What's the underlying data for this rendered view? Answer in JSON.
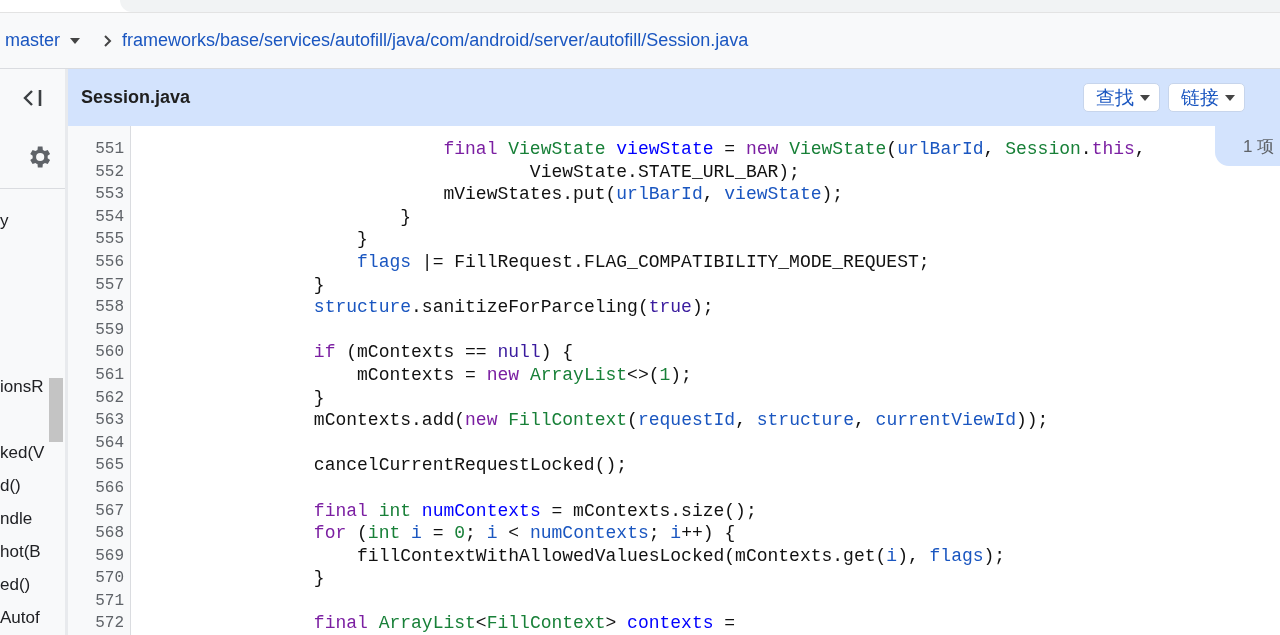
{
  "breadcrumb": {
    "branch": "master",
    "path": "frameworks/base/services/autofill/java/com/android/server/autofill/Session.java"
  },
  "file_header": {
    "title": "Session.java",
    "buttons": [
      {
        "label": "查找",
        "kind": "dropdown"
      },
      {
        "label": "链接",
        "kind": "dropdown"
      }
    ]
  },
  "side_tab": {
    "label": "1 项"
  },
  "sidebar": {
    "items": [
      {
        "kind": "text",
        "label": "y"
      },
      {
        "kind": "blank"
      },
      {
        "kind": "blank"
      },
      {
        "kind": "blank"
      },
      {
        "kind": "blank"
      },
      {
        "kind": "text",
        "label": "ionsR"
      },
      {
        "kind": "blank"
      },
      {
        "kind": "text",
        "label": "ked(V"
      },
      {
        "kind": "text",
        "label": "d()"
      },
      {
        "kind": "text",
        "label": "ndle"
      },
      {
        "kind": "text",
        "label": "hot(B"
      },
      {
        "kind": "text",
        "label": "ed()"
      },
      {
        "kind": "text",
        "label": "Autof"
      }
    ]
  },
  "code": {
    "lines": [
      {
        "number": "551",
        "tokens": [
          {
            "kind": "keyword",
            "text": "                            final "
          },
          {
            "kind": "type",
            "text": "ViewState "
          },
          {
            "kind": "decl",
            "text": "viewState"
          },
          {
            "kind": "plain",
            "text": " = "
          },
          {
            "kind": "keyword",
            "text": "new "
          },
          {
            "kind": "type",
            "text": "ViewState"
          },
          {
            "kind": "plain",
            "text": "("
          },
          {
            "kind": "ident",
            "text": "urlBarId"
          },
          {
            "kind": "plain",
            "text": ", "
          },
          {
            "kind": "type",
            "text": "Session"
          },
          {
            "kind": "plain",
            "text": "."
          },
          {
            "kind": "keyword",
            "text": "this"
          },
          {
            "kind": "plain",
            "text": ","
          }
        ]
      },
      {
        "number": "552",
        "tokens": [
          {
            "kind": "plain",
            "text": "                                    ViewState.STATE_URL_BAR);"
          }
        ]
      },
      {
        "number": "553",
        "tokens": [
          {
            "kind": "plain",
            "text": "                            mViewStates.put("
          },
          {
            "kind": "ident",
            "text": "urlBarId"
          },
          {
            "kind": "plain",
            "text": ", "
          },
          {
            "kind": "ident",
            "text": "viewState"
          },
          {
            "kind": "plain",
            "text": ");"
          }
        ]
      },
      {
        "number": "554",
        "tokens": [
          {
            "kind": "plain",
            "text": "                        }"
          }
        ]
      },
      {
        "number": "555",
        "tokens": [
          {
            "kind": "plain",
            "text": "                    }"
          }
        ]
      },
      {
        "number": "556",
        "tokens": [
          {
            "kind": "ident",
            "text": "                    flags"
          },
          {
            "kind": "plain",
            "text": " |= FillRequest.FLAG_COMPATIBILITY_MODE_REQUEST;"
          }
        ]
      },
      {
        "number": "557",
        "tokens": [
          {
            "kind": "plain",
            "text": "                }"
          }
        ]
      },
      {
        "number": "558",
        "tokens": [
          {
            "kind": "ident",
            "text": "                structure"
          },
          {
            "kind": "plain",
            "text": ".sanitizeForParceling("
          },
          {
            "kind": "literal",
            "text": "true"
          },
          {
            "kind": "plain",
            "text": ");"
          }
        ]
      },
      {
        "number": "559"
      },
      {
        "number": "560",
        "tokens": [
          {
            "kind": "keyword",
            "text": "                if"
          },
          {
            "kind": "plain",
            "text": " (mContexts == "
          },
          {
            "kind": "literal",
            "text": "null"
          },
          {
            "kind": "plain",
            "text": ") {"
          }
        ]
      },
      {
        "number": "561",
        "tokens": [
          {
            "kind": "plain",
            "text": "                    mContexts = "
          },
          {
            "kind": "keyword",
            "text": "new "
          },
          {
            "kind": "type",
            "text": "ArrayList"
          },
          {
            "kind": "plain",
            "text": "<>("
          },
          {
            "kind": "number",
            "text": "1"
          },
          {
            "kind": "plain",
            "text": ");"
          }
        ]
      },
      {
        "number": "562",
        "tokens": [
          {
            "kind": "plain",
            "text": "                }"
          }
        ]
      },
      {
        "number": "563",
        "tokens": [
          {
            "kind": "plain",
            "text": "                mContexts.add("
          },
          {
            "kind": "keyword",
            "text": "new "
          },
          {
            "kind": "type",
            "text": "FillContext"
          },
          {
            "kind": "plain",
            "text": "("
          },
          {
            "kind": "ident",
            "text": "requestId"
          },
          {
            "kind": "plain",
            "text": ", "
          },
          {
            "kind": "ident",
            "text": "structure"
          },
          {
            "kind": "plain",
            "text": ", "
          },
          {
            "kind": "ident",
            "text": "currentViewId"
          },
          {
            "kind": "plain",
            "text": "));"
          }
        ]
      },
      {
        "number": "564"
      },
      {
        "number": "565",
        "tokens": [
          {
            "kind": "plain",
            "text": "                cancelCurrentRequestLocked();"
          }
        ]
      },
      {
        "number": "566"
      },
      {
        "number": "567",
        "tokens": [
          {
            "kind": "keyword",
            "text": "                final "
          },
          {
            "kind": "type",
            "text": "int "
          },
          {
            "kind": "decl",
            "text": "numContexts"
          },
          {
            "kind": "plain",
            "text": " = mContexts.size();"
          }
        ]
      },
      {
        "number": "568",
        "tokens": [
          {
            "kind": "keyword",
            "text": "                for"
          },
          {
            "kind": "plain",
            "text": " ("
          },
          {
            "kind": "type",
            "text": "int "
          },
          {
            "kind": "ident",
            "text": "i"
          },
          {
            "kind": "plain",
            "text": " = "
          },
          {
            "kind": "number",
            "text": "0"
          },
          {
            "kind": "plain",
            "text": "; "
          },
          {
            "kind": "ident",
            "text": "i"
          },
          {
            "kind": "plain",
            "text": " < "
          },
          {
            "kind": "ident",
            "text": "numContexts"
          },
          {
            "kind": "plain",
            "text": "; "
          },
          {
            "kind": "ident",
            "text": "i"
          },
          {
            "kind": "plain",
            "text": "++) {"
          }
        ]
      },
      {
        "number": "569",
        "tokens": [
          {
            "kind": "plain",
            "text": "                    fillContextWithAllowedValuesLocked(mContexts.get("
          },
          {
            "kind": "ident",
            "text": "i"
          },
          {
            "kind": "plain",
            "text": "), "
          },
          {
            "kind": "ident",
            "text": "flags"
          },
          {
            "kind": "plain",
            "text": ");"
          }
        ]
      },
      {
        "number": "570",
        "tokens": [
          {
            "kind": "plain",
            "text": "                }"
          }
        ]
      },
      {
        "number": "571"
      },
      {
        "number": "572",
        "tokens": [
          {
            "kind": "keyword",
            "text": "                final "
          },
          {
            "kind": "type",
            "text": "ArrayList"
          },
          {
            "kind": "plain",
            "text": "<"
          },
          {
            "kind": "type",
            "text": "FillContext"
          },
          {
            "kind": "plain",
            "text": "> "
          },
          {
            "kind": "decl",
            "text": "contexts"
          },
          {
            "kind": "plain",
            "text": " ="
          }
        ]
      }
    ]
  }
}
